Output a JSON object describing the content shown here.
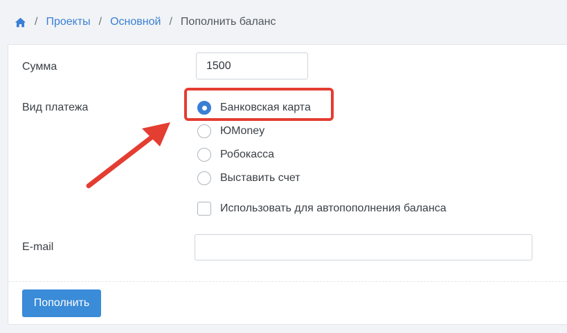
{
  "breadcrumb": {
    "home_icon": "home-icon",
    "items": [
      "Проекты",
      "Основной"
    ],
    "separator": "/",
    "current": "Пополнить баланс"
  },
  "form": {
    "amount_label": "Сумма",
    "amount_value": "1500",
    "payment_type_label": "Вид платежа",
    "payment_options": [
      {
        "label": "Банковская карта",
        "selected": true
      },
      {
        "label": "ЮMoney",
        "selected": false
      },
      {
        "label": "Робокасса",
        "selected": false
      },
      {
        "label": "Выставить счет",
        "selected": false
      }
    ],
    "autorefill_label": "Использовать для автопополнения баланса",
    "autorefill_checked": false,
    "email_label": "E-mail",
    "email_value": "",
    "submit_label": "Пополнить"
  },
  "colors": {
    "accent": "#3a7fd5",
    "button": "#3a8bd8",
    "annotation": "#e43d31"
  }
}
